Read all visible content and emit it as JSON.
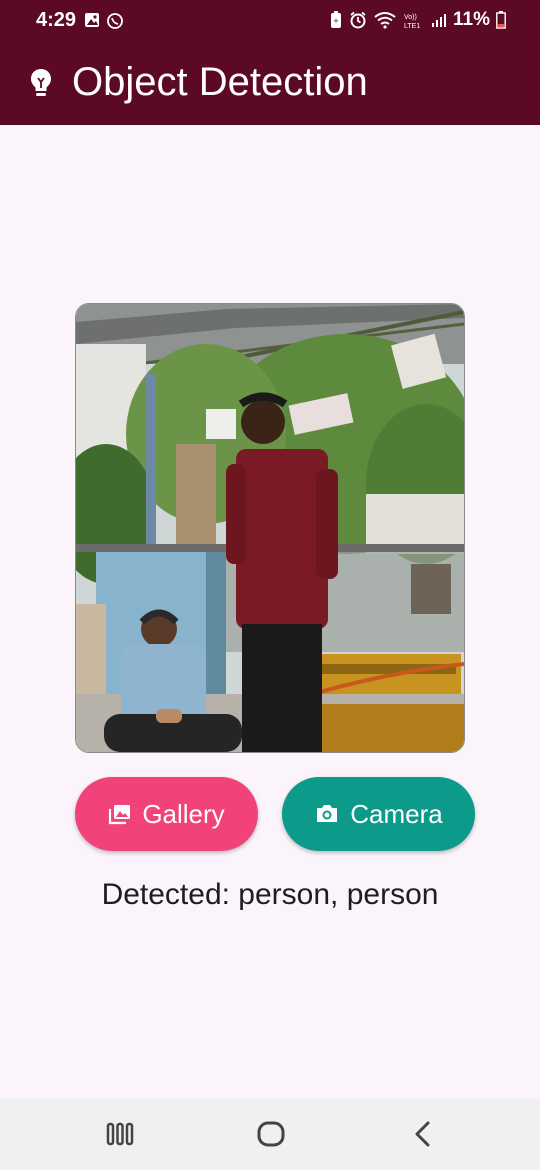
{
  "status_bar": {
    "time": "4:29",
    "battery": "11%",
    "network_label": "VoLTE1"
  },
  "app_bar": {
    "title": "Object Detection",
    "icon": "lightbulb-icon",
    "background": "#5c0a24"
  },
  "image": {
    "description_icon": "photo-preview"
  },
  "buttons": {
    "gallery_label": "Gallery",
    "gallery_icon": "image-icon",
    "gallery_color": "#f2427a",
    "camera_label": "Camera",
    "camera_icon": "camera-icon",
    "camera_color": "#0c9a8a"
  },
  "result": {
    "text": "Detected: person, person"
  },
  "nav_bar": {
    "items": [
      "recent-apps",
      "home",
      "back"
    ]
  }
}
